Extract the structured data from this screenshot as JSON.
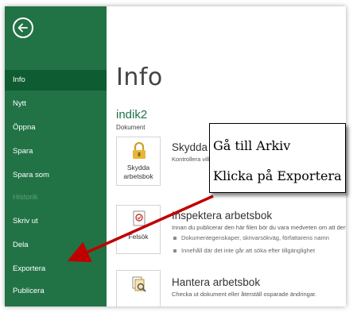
{
  "sidebar": {
    "items": [
      {
        "label": "Info",
        "active": true
      },
      {
        "label": "Nytt"
      },
      {
        "label": "Öppna"
      },
      {
        "label": "Spara"
      },
      {
        "label": "Spara som"
      },
      {
        "label": "Historik",
        "disabled": true
      },
      {
        "label": "Skriv ut"
      },
      {
        "label": "Dela"
      },
      {
        "label": "Exportera"
      },
      {
        "label": "Publicera"
      }
    ]
  },
  "main": {
    "title": "Info",
    "doc_name": "indik2",
    "doc_type": "Dokument",
    "sections": [
      {
        "tile_label": "Skydda arbetsbok",
        "tile_icon": "lock-icon",
        "title": "Skydda arbetsbok",
        "description": "Kontrollera vilken typ av ändringar andra kan göra i den här arbetsboken."
      },
      {
        "tile_label": "Felsök",
        "tile_icon": "inspect-icon",
        "title": "Inspektera arbetsbok",
        "description": "Innan du publicerar den här filen bör du vara medveten om att den innehåller:",
        "bullets": [
          "Dokumentegenskaper, skrivarsökväg, författarens namn",
          "Innehåll där det inte går att söka efter tillgänglighet"
        ]
      },
      {
        "tile_icon": "manage-icon",
        "title": "Hantera arbetsbok",
        "description": "Checka ut dokument eller återställ osparade ändringar."
      }
    ]
  },
  "callout": {
    "line1": "Gå till Arkiv",
    "line2": "Klicka på Exportera"
  },
  "colors": {
    "sidebar": "#217346",
    "sidebar_active": "#0e5c31",
    "arrow": "#c00000"
  }
}
